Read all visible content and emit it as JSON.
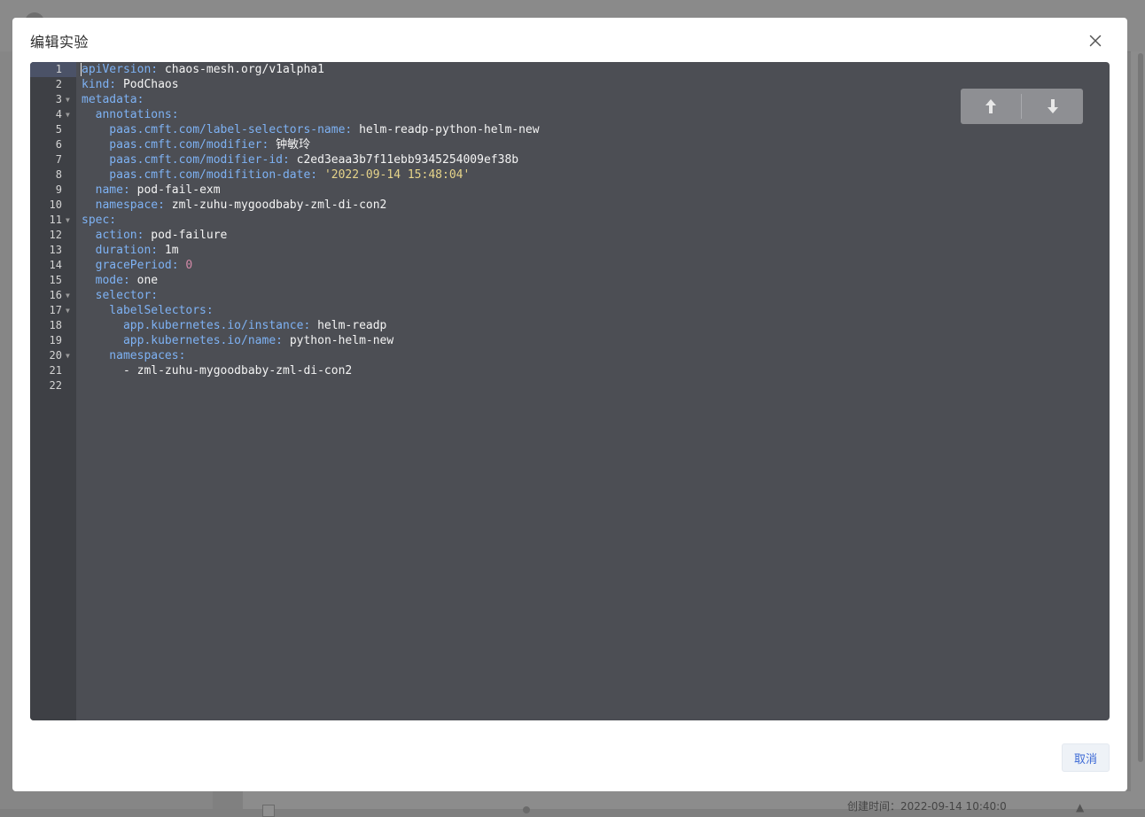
{
  "background": {
    "created_label": "创建时间：2022-09-14 10:40:0"
  },
  "modal": {
    "title": "编辑实验",
    "cancel_label": "取消",
    "close_icon": "close-icon",
    "nav_up_icon": "arrow-up-icon",
    "nav_down_icon": "arrow-down-icon"
  },
  "editor": {
    "lines": [
      {
        "no": "1",
        "fold": false,
        "parts": [
          {
            "t": "apiVersion: ",
            "c": "k"
          },
          {
            "t": "chaos-mesh.org/v1alpha1",
            "c": "v"
          }
        ]
      },
      {
        "no": "2",
        "fold": false,
        "parts": [
          {
            "t": "kind: ",
            "c": "k"
          },
          {
            "t": "PodChaos",
            "c": "v"
          }
        ]
      },
      {
        "no": "3",
        "fold": true,
        "parts": [
          {
            "t": "metadata:",
            "c": "k"
          }
        ]
      },
      {
        "no": "4",
        "fold": true,
        "parts": [
          {
            "t": "  annotations:",
            "c": "k"
          }
        ]
      },
      {
        "no": "5",
        "fold": false,
        "parts": [
          {
            "t": "    paas.cmft.com/label-selectors-name: ",
            "c": "k"
          },
          {
            "t": "helm-readp-python-helm-new",
            "c": "v"
          }
        ]
      },
      {
        "no": "6",
        "fold": false,
        "parts": [
          {
            "t": "    paas.cmft.com/modifier: ",
            "c": "k"
          },
          {
            "t": "钟敏玲",
            "c": "v"
          }
        ]
      },
      {
        "no": "7",
        "fold": false,
        "parts": [
          {
            "t": "    paas.cmft.com/modifier-id: ",
            "c": "k"
          },
          {
            "t": "c2ed3eaa3b7f11ebb9345254009ef38b",
            "c": "v"
          }
        ]
      },
      {
        "no": "8",
        "fold": false,
        "parts": [
          {
            "t": "    paas.cmft.com/modifition-date: ",
            "c": "k"
          },
          {
            "t": "'2022-09-14 15:48:04'",
            "c": "s"
          }
        ]
      },
      {
        "no": "9",
        "fold": false,
        "parts": [
          {
            "t": "  name: ",
            "c": "k"
          },
          {
            "t": "pod-fail-exm",
            "c": "v"
          }
        ]
      },
      {
        "no": "10",
        "fold": false,
        "parts": [
          {
            "t": "  namespace: ",
            "c": "k"
          },
          {
            "t": "zml-zuhu-mygoodbaby-zml-di-con2",
            "c": "v"
          }
        ]
      },
      {
        "no": "11",
        "fold": true,
        "parts": [
          {
            "t": "spec:",
            "c": "k"
          }
        ]
      },
      {
        "no": "12",
        "fold": false,
        "parts": [
          {
            "t": "  action: ",
            "c": "k"
          },
          {
            "t": "pod-failure",
            "c": "v"
          }
        ]
      },
      {
        "no": "13",
        "fold": false,
        "parts": [
          {
            "t": "  duration: ",
            "c": "k"
          },
          {
            "t": "1m",
            "c": "v"
          }
        ]
      },
      {
        "no": "14",
        "fold": false,
        "parts": [
          {
            "t": "  gracePeriod: ",
            "c": "k"
          },
          {
            "t": "0",
            "c": "n"
          }
        ]
      },
      {
        "no": "15",
        "fold": false,
        "parts": [
          {
            "t": "  mode: ",
            "c": "k"
          },
          {
            "t": "one",
            "c": "v"
          }
        ]
      },
      {
        "no": "16",
        "fold": true,
        "parts": [
          {
            "t": "  selector:",
            "c": "k"
          }
        ]
      },
      {
        "no": "17",
        "fold": true,
        "parts": [
          {
            "t": "    labelSelectors:",
            "c": "k"
          }
        ]
      },
      {
        "no": "18",
        "fold": false,
        "parts": [
          {
            "t": "      app.kubernetes.io/instance: ",
            "c": "k"
          },
          {
            "t": "helm-readp",
            "c": "v"
          }
        ]
      },
      {
        "no": "19",
        "fold": false,
        "parts": [
          {
            "t": "      app.kubernetes.io/name: ",
            "c": "k"
          },
          {
            "t": "python-helm-new",
            "c": "v"
          }
        ]
      },
      {
        "no": "20",
        "fold": true,
        "parts": [
          {
            "t": "    namespaces:",
            "c": "k"
          }
        ]
      },
      {
        "no": "21",
        "fold": false,
        "parts": [
          {
            "t": "      - zml-zuhu-mygoodbaby-zml-di-con2",
            "c": "v"
          }
        ]
      },
      {
        "no": "22",
        "fold": false,
        "parts": []
      }
    ]
  }
}
